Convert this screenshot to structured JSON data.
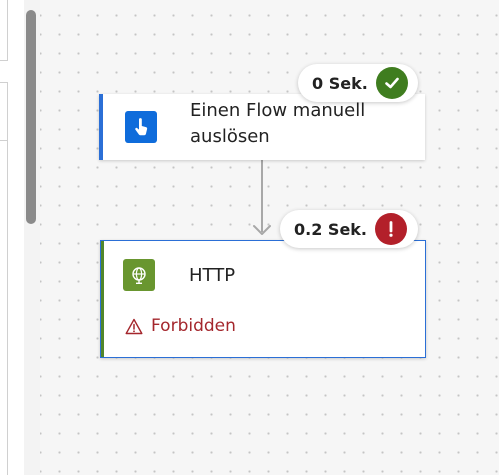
{
  "flow": {
    "trigger": {
      "title": "Einen Flow manuell auslösen",
      "duration": "0 Sek.",
      "status": "success",
      "icon": "hand-pointer-icon",
      "accent_color": "#0f6cdb"
    },
    "http": {
      "title": "HTTP",
      "duration": "0.2 Sek.",
      "status": "error",
      "icon": "globe-icon",
      "accent_color": "#69962f",
      "error_message": "Forbidden"
    }
  },
  "colors": {
    "success": "#3f7d1f",
    "error": "#b3202a",
    "selection_border": "#2b6fd6"
  }
}
